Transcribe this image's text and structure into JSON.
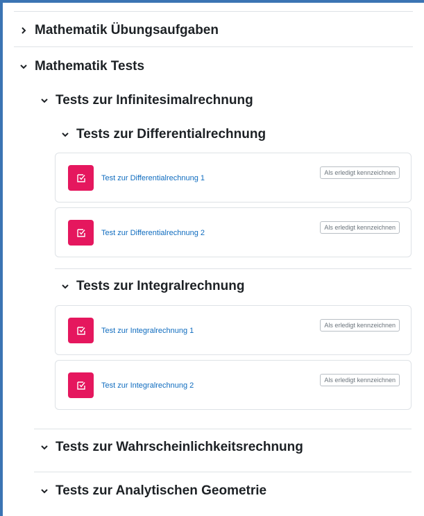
{
  "sections": [
    {
      "title": "Mathematik Übungsaufgaben",
      "state": "collapsed"
    },
    {
      "title": "Mathematik Tests",
      "state": "expanded"
    }
  ],
  "subsections": {
    "infinitesimal": "Tests zur Infinitesimalrechnung",
    "differential": "Tests zur Differentialrechnung",
    "integral": "Tests zur Integralrechnung",
    "wahrscheinlichkeit": "Tests zur Wahrscheinlichkeitsrechnung",
    "geometrie": "Tests zur Analytischen Geometrie"
  },
  "activities": [
    {
      "name": "Test zur Differentialrechnung 1",
      "button": "Als erledigt kennzeichnen",
      "icon": "quiz-icon"
    },
    {
      "name": "Test zur Differentialrechnung 2",
      "button": "Als erledigt kennzeichnen",
      "icon": "quiz-icon"
    },
    {
      "name": "Test zur Integralrechnung 1",
      "button": "Als erledigt kennzeichnen",
      "icon": "quiz-icon"
    },
    {
      "name": "Test zur Integralrechnung 2",
      "button": "Als erledigt kennzeichnen",
      "icon": "quiz-icon"
    }
  ],
  "colors": {
    "accent_frame": "#3b74b3",
    "quiz_icon_bg": "#e5175e",
    "link": "#0f6cbf"
  }
}
